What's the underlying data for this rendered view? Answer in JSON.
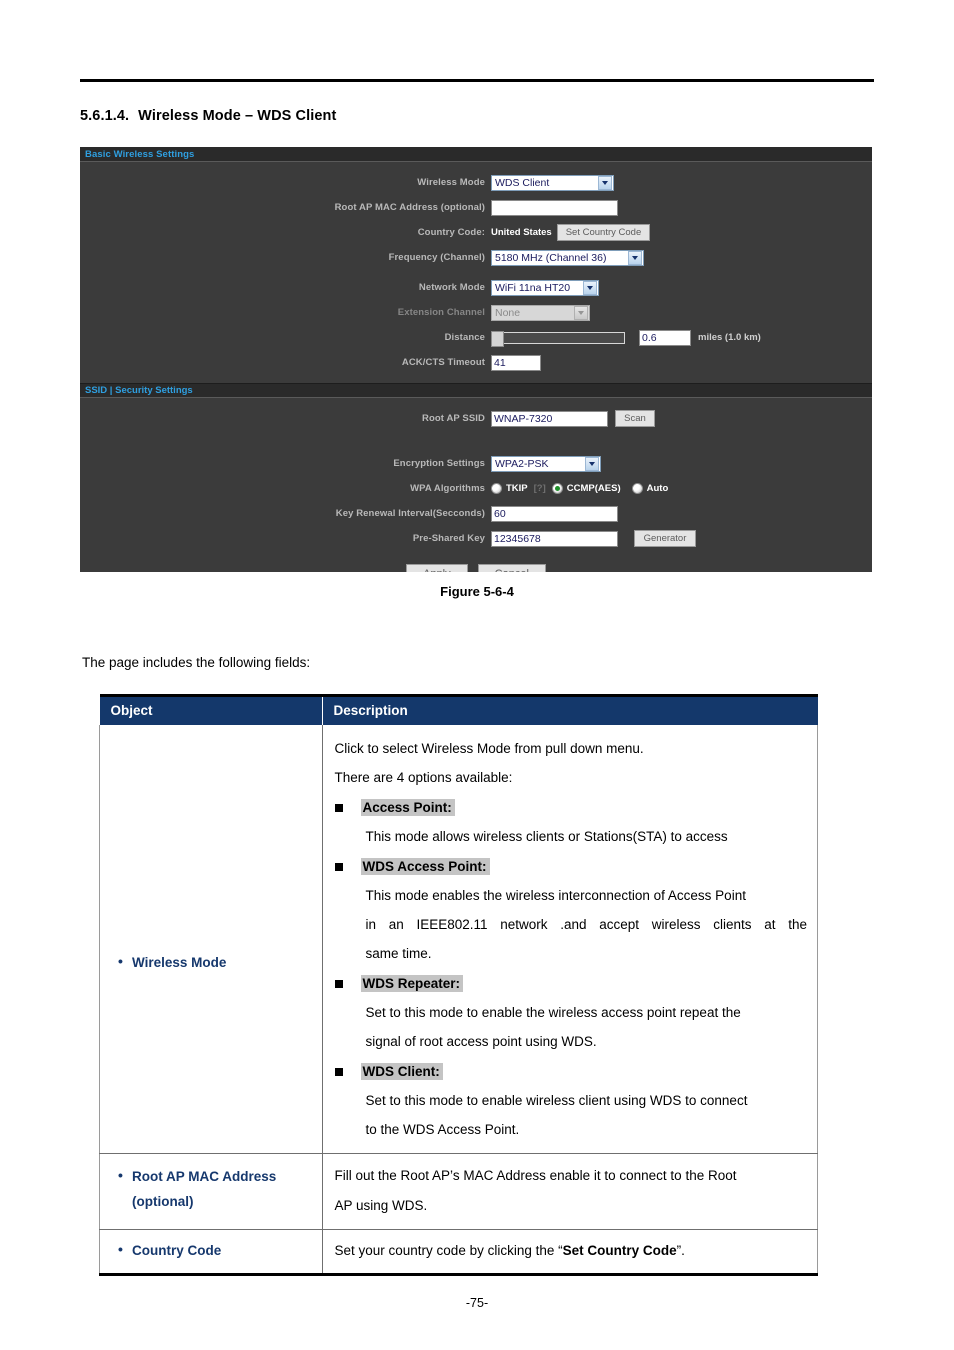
{
  "document": {
    "section_number": "5.6.1.4.",
    "section_title": "Wireless Mode – WDS Client",
    "figure_caption": "Figure 5-6-4",
    "intro_paragraph": "The page includes the following fields:",
    "page_number": "-75-"
  },
  "router_ui": {
    "basic_panel_title": "Basic Wireless Settings",
    "ssid_panel_title": "SSID | Security Settings",
    "fields": {
      "wireless_mode_label": "Wireless Mode",
      "wireless_mode_value": "WDS Client",
      "root_ap_mac_label": "Root AP MAC Address (optional)",
      "root_ap_mac_value": "",
      "country_code_label": "Country Code:",
      "country_code_value": "United States",
      "set_country_code_button": "Set Country Code",
      "frequency_label": "Frequency (Channel)",
      "frequency_value": "5180 MHz (Channel 36)",
      "network_mode_label": "Network Mode",
      "network_mode_value": "WiFi 11na HT20",
      "extension_channel_label": "Extension Channel",
      "extension_channel_value": "None",
      "distance_label": "Distance",
      "distance_value": "0.6",
      "distance_unit": "miles (1.0 km)",
      "ack_cts_label": "ACK/CTS Timeout",
      "ack_cts_value": "41",
      "root_ap_ssid_label": "Root AP SSID",
      "root_ap_ssid_value": "WNAP-7320",
      "scan_button": "Scan",
      "encryption_label": "Encryption Settings",
      "encryption_value": "WPA2-PSK",
      "wpa_algorithms_label": "WPA Algorithms",
      "wpa_help_marker": "[?]",
      "wpa_options": [
        {
          "label": "TKIP",
          "selected": false
        },
        {
          "label": "CCMP(AES)",
          "selected": true
        },
        {
          "label": "Auto",
          "selected": false
        }
      ],
      "key_renewal_label": "Key Renewal Interval(Secconds)",
      "key_renewal_value": "60",
      "pre_shared_key_label": "Pre-Shared Key",
      "pre_shared_key_value": "12345678",
      "generator_button": "Generator",
      "apply_button": "Apply",
      "cancel_button": "Cancel"
    }
  },
  "table": {
    "headers": {
      "object": "Object",
      "description": "Description"
    },
    "rows": [
      {
        "object_main": "Wireless Mode",
        "object_sub": "",
        "desc_intro": [
          "Click to select Wireless Mode from pull down menu.",
          "There are 4 options available:"
        ],
        "bullets": [
          {
            "term": "Access Point:",
            "body": [
              "This mode allows wireless clients or Stations(STA) to access"
            ]
          },
          {
            "term": "WDS Access Point:",
            "body": [
              "This mode enables the wireless interconnection of Access Point",
              "in an IEEE802.11 network .and accept wireless clients at the",
              "same time."
            ]
          },
          {
            "term": "WDS Repeater:",
            "body": [
              "Set to this mode to enable the wireless access point repeat the",
              "signal of root access point using WDS."
            ]
          },
          {
            "term": "WDS Client:",
            "body": [
              "Set to this mode to enable wireless client using WDS to connect",
              "to the WDS Access Point."
            ]
          }
        ]
      },
      {
        "object_main": "Root AP MAC Address",
        "object_sub": "(optional)",
        "desc_lines": [
          "Fill out the Root AP’s MAC Address enable it to connect to the Root",
          "AP using WDS."
        ]
      },
      {
        "object_main": "Country Code",
        "object_sub": "",
        "desc_prefix": "Set your country code by clicking the “",
        "desc_bold": "Set Country Code",
        "desc_suffix": "”."
      }
    ]
  }
}
